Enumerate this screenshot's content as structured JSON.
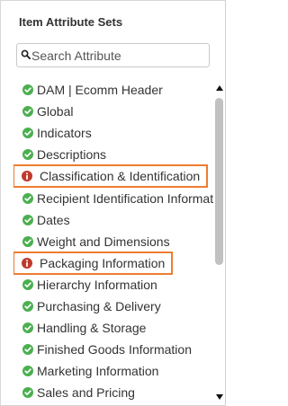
{
  "panel": {
    "title": "Item Attribute Sets"
  },
  "search": {
    "placeholder": "Search Attribute",
    "icon": "search-icon"
  },
  "colors": {
    "ok": "#4caf50",
    "error": "#c0392b",
    "highlight_border": "#ee7d30"
  },
  "items": [
    {
      "label": "DAM | Ecomm Header",
      "status": "ok"
    },
    {
      "label": "Global",
      "status": "ok"
    },
    {
      "label": "Indicators",
      "status": "ok"
    },
    {
      "label": "Descriptions",
      "status": "ok"
    },
    {
      "label": "Classification & Identification",
      "status": "error",
      "highlighted": true
    },
    {
      "label": "Recipient Identification Information",
      "status": "ok"
    },
    {
      "label": "Dates",
      "status": "ok"
    },
    {
      "label": "Weight and Dimensions",
      "status": "ok"
    },
    {
      "label": "Packaging Information",
      "status": "error",
      "highlighted": true
    },
    {
      "label": "Hierarchy Information",
      "status": "ok"
    },
    {
      "label": "Purchasing & Delivery",
      "status": "ok"
    },
    {
      "label": "Handling & Storage",
      "status": "ok"
    },
    {
      "label": "Finished Goods Information",
      "status": "ok"
    },
    {
      "label": "Marketing Information",
      "status": "ok"
    },
    {
      "label": "Sales and Pricing",
      "status": "ok"
    }
  ]
}
